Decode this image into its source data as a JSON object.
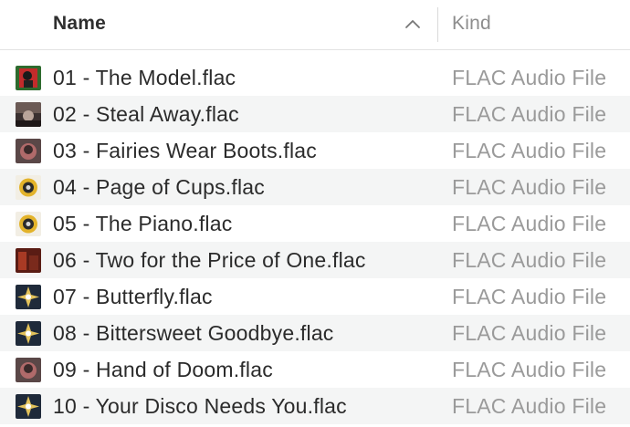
{
  "columns": {
    "name": "Name",
    "kind": "Kind",
    "sort_icon": "chevron-up-icon"
  },
  "files": [
    {
      "name": "01 - The Model.flac",
      "kind": "FLAC Audio File",
      "artwork": "album-art-red-icon"
    },
    {
      "name": "02 - Steal Away.flac",
      "kind": "FLAC Audio File",
      "artwork": "album-art-dark-icon"
    },
    {
      "name": "03 - Fairies Wear Boots.flac",
      "kind": "FLAC Audio File",
      "artwork": "album-art-portrait-icon"
    },
    {
      "name": "04 - Page of Cups.flac",
      "kind": "FLAC Audio File",
      "artwork": "album-art-emblem-icon"
    },
    {
      "name": "05 - The Piano.flac",
      "kind": "FLAC Audio File",
      "artwork": "album-art-emblem-icon"
    },
    {
      "name": "06 - Two for the Price of One.flac",
      "kind": "FLAC Audio File",
      "artwork": "album-art-red-dark-icon"
    },
    {
      "name": "07 - Butterfly.flac",
      "kind": "FLAC Audio File",
      "artwork": "album-art-starburst-icon"
    },
    {
      "name": "08 - Bittersweet Goodbye.flac",
      "kind": "FLAC Audio File",
      "artwork": "album-art-starburst-icon"
    },
    {
      "name": "09 - Hand of Doom.flac",
      "kind": "FLAC Audio File",
      "artwork": "album-art-portrait-icon"
    },
    {
      "name": "10 - Your Disco Needs You.flac",
      "kind": "FLAC Audio File",
      "artwork": "album-art-starburst-icon"
    }
  ],
  "colors": {
    "header_text": "#2f2f2f",
    "kind_text": "#9a9a9a",
    "alt_row": "#f4f5f5"
  }
}
